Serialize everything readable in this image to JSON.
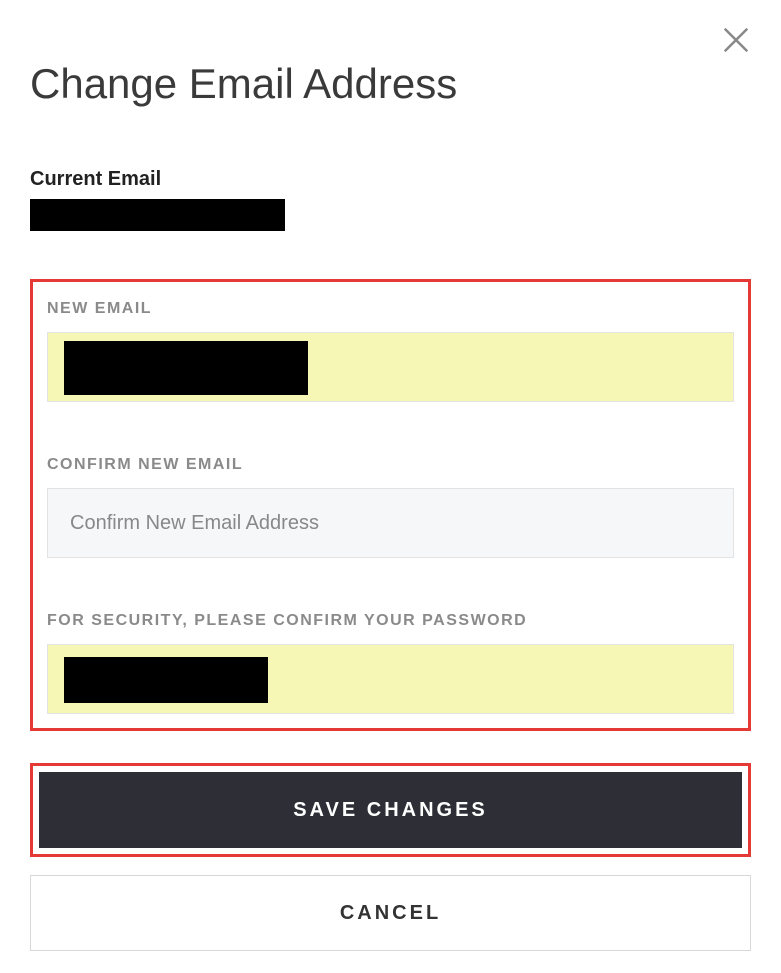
{
  "title": "Change Email Address",
  "close_icon": "close",
  "current_email": {
    "label": "Current Email"
  },
  "fields": {
    "new_email": {
      "label": "NEW EMAIL"
    },
    "confirm_email": {
      "label": "CONFIRM NEW EMAIL",
      "placeholder": "Confirm New Email Address",
      "value": ""
    },
    "password": {
      "label": "FOR SECURITY, PLEASE CONFIRM YOUR PASSWORD"
    }
  },
  "buttons": {
    "save": "SAVE CHANGES",
    "cancel": "CANCEL"
  }
}
